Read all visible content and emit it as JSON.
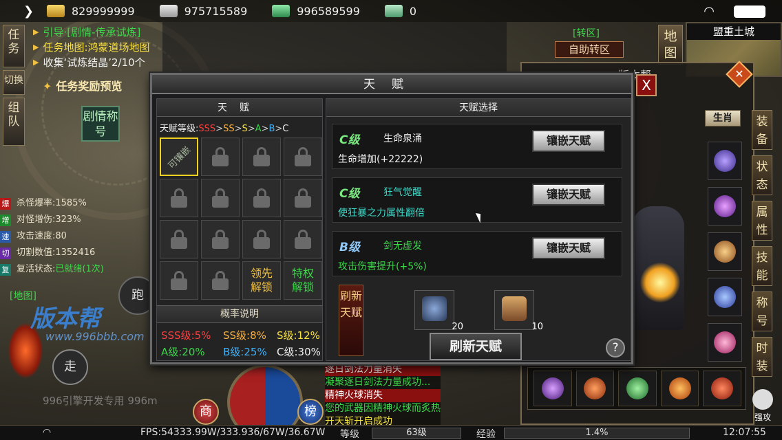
{
  "topbar": {
    "resources": [
      {
        "icon": "gold-ingot-icon",
        "value": "829999999"
      },
      {
        "icon": "silver-ingot-icon",
        "value": "975715589"
      },
      {
        "icon": "money-bag-icon",
        "value": "996589599"
      },
      {
        "icon": "bound-money-icon",
        "value": "0"
      }
    ]
  },
  "quest": {
    "tab_task": "任务",
    "tab_switch": "切换",
    "tab_team": "组队",
    "items": [
      {
        "text": "引导·[剧情-传承试炼]"
      },
      {
        "text": "任务地图:鸿蒙道场地图"
      },
      {
        "text": "收集‘试炼结晶’2/10个"
      }
    ],
    "reward_preview": "任务奖励预览",
    "story_title_btn": "剧情称号"
  },
  "stats": [
    {
      "tag": "爆",
      "label": "杀怪爆率:",
      "value": "1585%"
    },
    {
      "tag": "增",
      "label": "对怪增伤:",
      "value": "323%"
    },
    {
      "tag": "速",
      "label": "攻击速度:",
      "value": "80"
    },
    {
      "tag": "切",
      "label": "切割数值:",
      "value": "1352416"
    },
    {
      "tag": "复",
      "label": "复活状态:",
      "value": "已就绪(1次)"
    }
  ],
  "left_lower": {
    "map_label": "[地图]",
    "brand": "版本帮",
    "brand_url": "www.996bbb.com",
    "run_btn": "跑",
    "walk_btn": "走",
    "dev_mark": "996引擎开发专用 996m",
    "shop_btn": "商",
    "rank_btn": "榜"
  },
  "chat": [
    "逐日剑法力量消失",
    "凝聚逐日剑法力量成功...",
    "精神火球消失",
    "您的武器因精神火球而炙热",
    "开天斩开启成功"
  ],
  "bottombar": {
    "fps": "FPS:54333.99W/333.936/67W/36.67W",
    "level_label": "等级",
    "level_value": "63级",
    "exp_label": "经验",
    "exp_value": "1.4%",
    "clock": "12:07:55"
  },
  "right": {
    "map_btn": "地图",
    "minimap_title": "盟重土城",
    "zone_label": "[转区]",
    "zone_btn": "自助转区",
    "char_title": "版本帮",
    "gender_btn": "生肖",
    "side_tabs": [
      "装备",
      "状态",
      "属性",
      "技能",
      "称号",
      "时装"
    ],
    "strong_attack": "强攻"
  },
  "talent": {
    "window_title": "天赋",
    "left_header": "天赋",
    "tier_label": "天赋等级:",
    "tiers": [
      "SSS",
      "SS",
      "S",
      "A",
      "B",
      "C"
    ],
    "embeddable": "可镶嵌",
    "unlock_lead": "领先解锁",
    "unlock_priv": "特权解锁",
    "prob_header": "概率说明",
    "probabilities": [
      {
        "label": "SSS级:",
        "value": "5%"
      },
      {
        "label": "SS级:",
        "value": "8%"
      },
      {
        "label": "S级:",
        "value": "12%"
      },
      {
        "label": "A级:",
        "value": "20%"
      },
      {
        "label": "B级:",
        "value": "25%"
      },
      {
        "label": "C级:",
        "value": "30%"
      }
    ],
    "right_header": "天赋选择",
    "cards": [
      {
        "grade": "C级",
        "name": "生命泉涌",
        "desc": "生命增加(+22222)",
        "button": "镶嵌天赋"
      },
      {
        "grade": "C级",
        "name": "狂气觉醒",
        "desc": "使狂暴之力属性翻倍",
        "button": "镶嵌天赋"
      },
      {
        "grade": "B级",
        "name": "剑无虚发",
        "desc": "攻击伤害提升(+5%)",
        "button": "镶嵌天赋"
      }
    ],
    "refresh_banner": "刷新天赋",
    "materials": [
      {
        "icon": "blue-stone-icon",
        "count": "20"
      },
      {
        "icon": "scroll-bundle-icon",
        "count": "10"
      }
    ],
    "refresh_btn": "刷新天赋",
    "help_btn": "?",
    "close_btn": "X"
  },
  "colors": {
    "green_text": "#3cd84a",
    "yellow_text": "#f8e040",
    "sss_red": "#f84040",
    "panel_bg": "#1c1c1e"
  }
}
